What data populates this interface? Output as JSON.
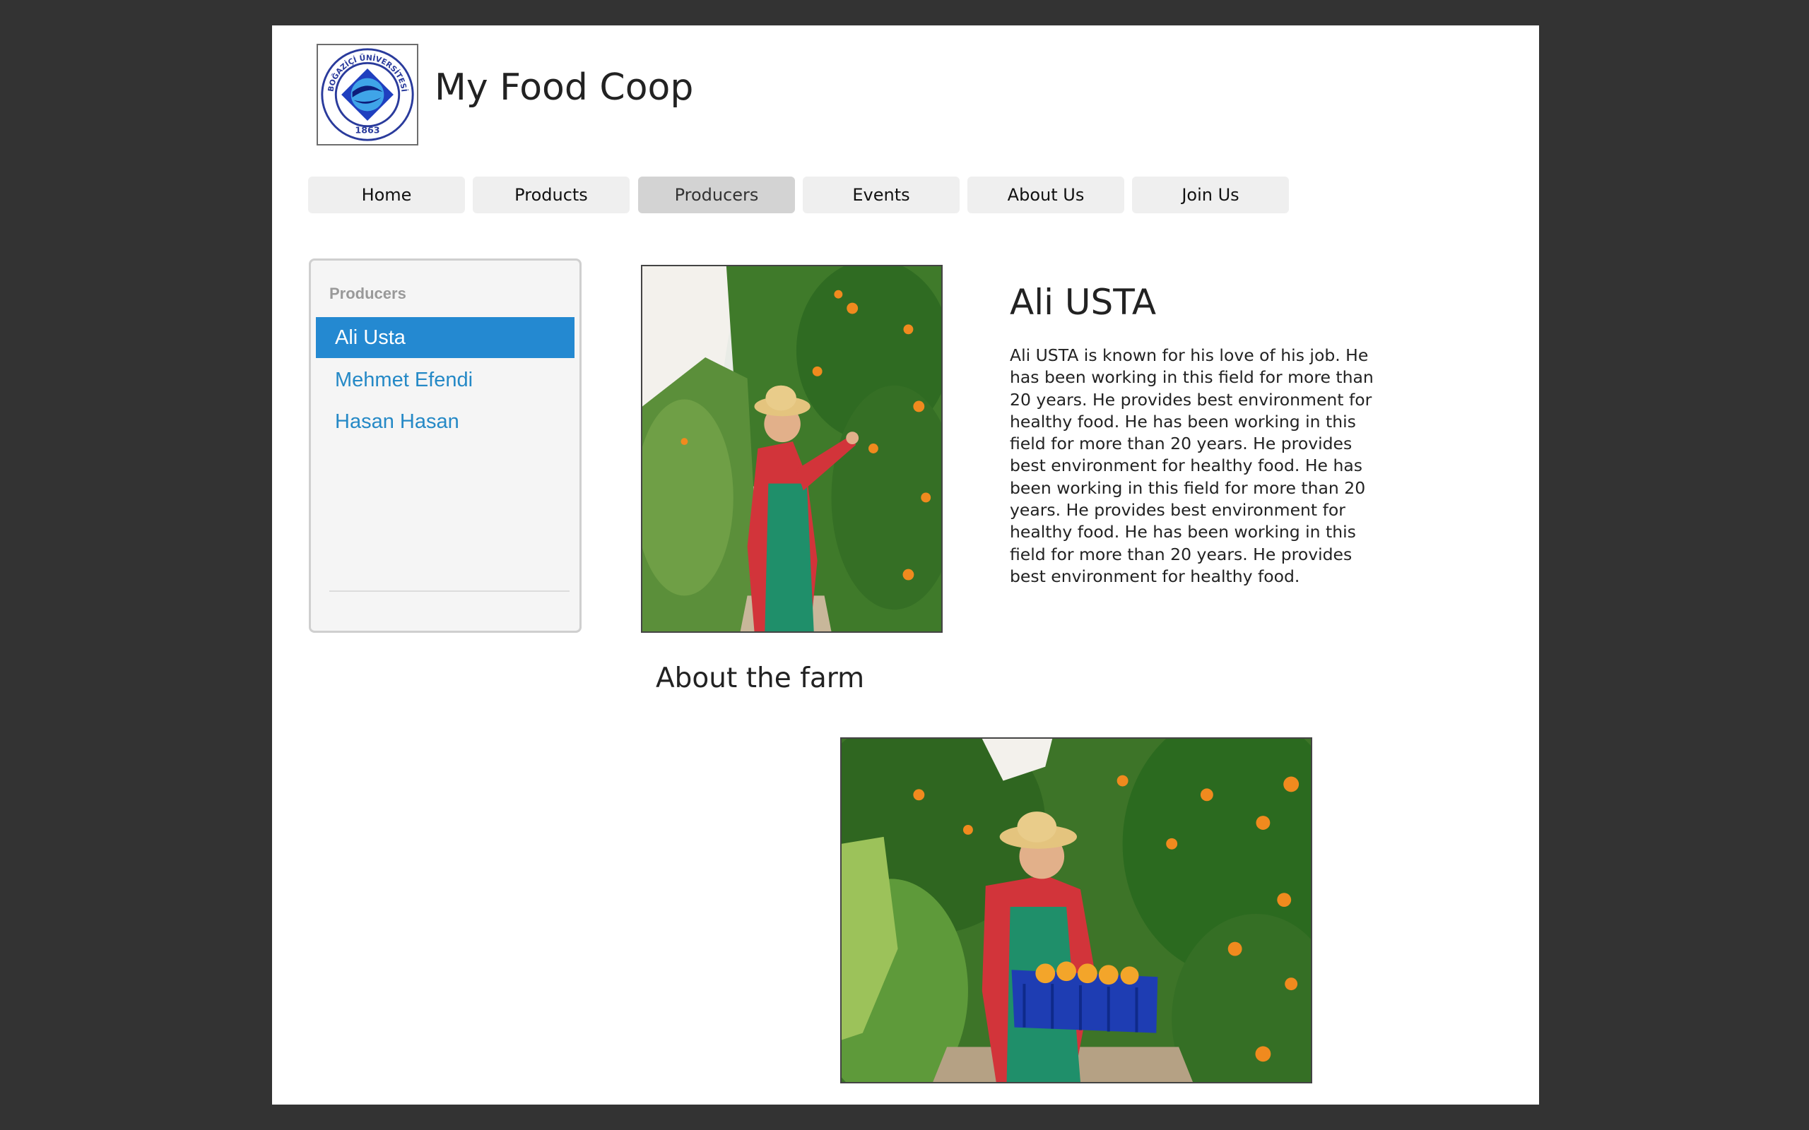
{
  "header": {
    "logo_text": "BOĞAZİÇİ ÜNİVERSİTESİ 1863",
    "title": "My Food Coop"
  },
  "nav": {
    "items": [
      {
        "label": "Home",
        "active": false
      },
      {
        "label": "Products",
        "active": false
      },
      {
        "label": "Producers",
        "active": true
      },
      {
        "label": "Events",
        "active": false
      },
      {
        "label": "About Us",
        "active": false
      },
      {
        "label": "Join Us",
        "active": false
      }
    ]
  },
  "sidebar": {
    "heading": "Producers",
    "items": [
      {
        "label": "Ali Usta",
        "active": true
      },
      {
        "label": "Mehmet Efendi",
        "active": false
      },
      {
        "label": "Hasan Hasan",
        "active": false
      }
    ]
  },
  "profile": {
    "name": "Ali USTA",
    "bio": "Ali USTA is known for his love of his job. He has been working in this field for more than 20 years. He provides best environment for healthy food.  He has been working in this field for more than 20 years. He provides best environment for healthy food.  He has been working in this field for more than 20 years. He provides best environment for healthy food.  He has been working in this field for more than 20 years. He provides best environment for healthy food."
  },
  "farm": {
    "heading": "About the farm"
  },
  "colors": {
    "accent": "#2489d1",
    "link": "#2589c6",
    "nav_bg": "#efefef",
    "nav_active_bg": "#d3d3d3",
    "backdrop": "#333333"
  }
}
